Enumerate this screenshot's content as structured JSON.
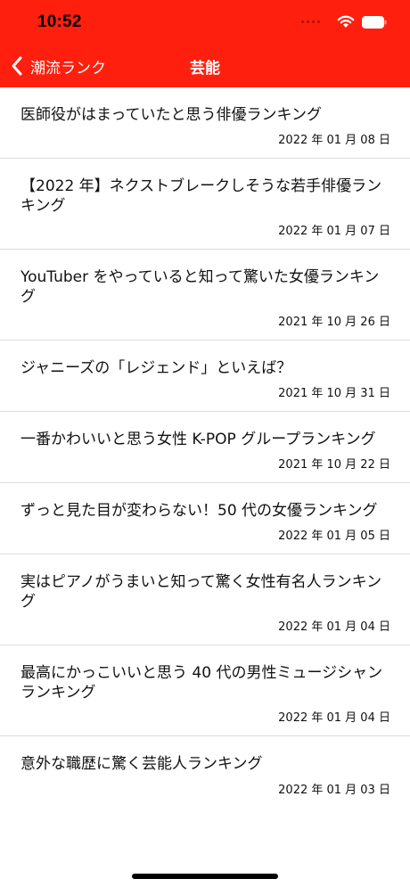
{
  "status_bar": {
    "time": "10:52"
  },
  "nav": {
    "back_label": "潮流ランク",
    "title": "芸能"
  },
  "colors": {
    "header_bg": "#fe1f0e",
    "header_text": "#ffffff"
  },
  "articles": [
    {
      "title": "医師役がはまっていたと思う俳優ランキング",
      "date": "2022 年 01 月 08 日"
    },
    {
      "title": "【2022 年】ネクストブレークしそうな若手俳優ランキング",
      "date": "2022 年 01 月 07 日"
    },
    {
      "title": "YouTuber をやっていると知って驚いた女優ランキング",
      "date": "2021 年 10 月 26 日"
    },
    {
      "title": "ジャニーズの「レジェンド」といえば？",
      "date": "2021 年 10 月 31 日"
    },
    {
      "title": "一番かわいいと思う女性 K-POP グループランキング",
      "date": "2021 年 10 月 22 日"
    },
    {
      "title": "ずっと見た目が変わらない！50 代の女優ランキング",
      "date": "2022 年 01 月 05 日"
    },
    {
      "title": "実はピアノがうまいと知って驚く女性有名人ランキング",
      "date": "2022 年 01 月 04 日"
    },
    {
      "title": "最高にかっこいいと思う 40 代の男性ミュージシャンランキング",
      "date": "2022 年 01 月 04 日"
    },
    {
      "title": "意外な職歴に驚く芸能人ランキング",
      "date": "2022 年 01 月 03 日"
    }
  ]
}
